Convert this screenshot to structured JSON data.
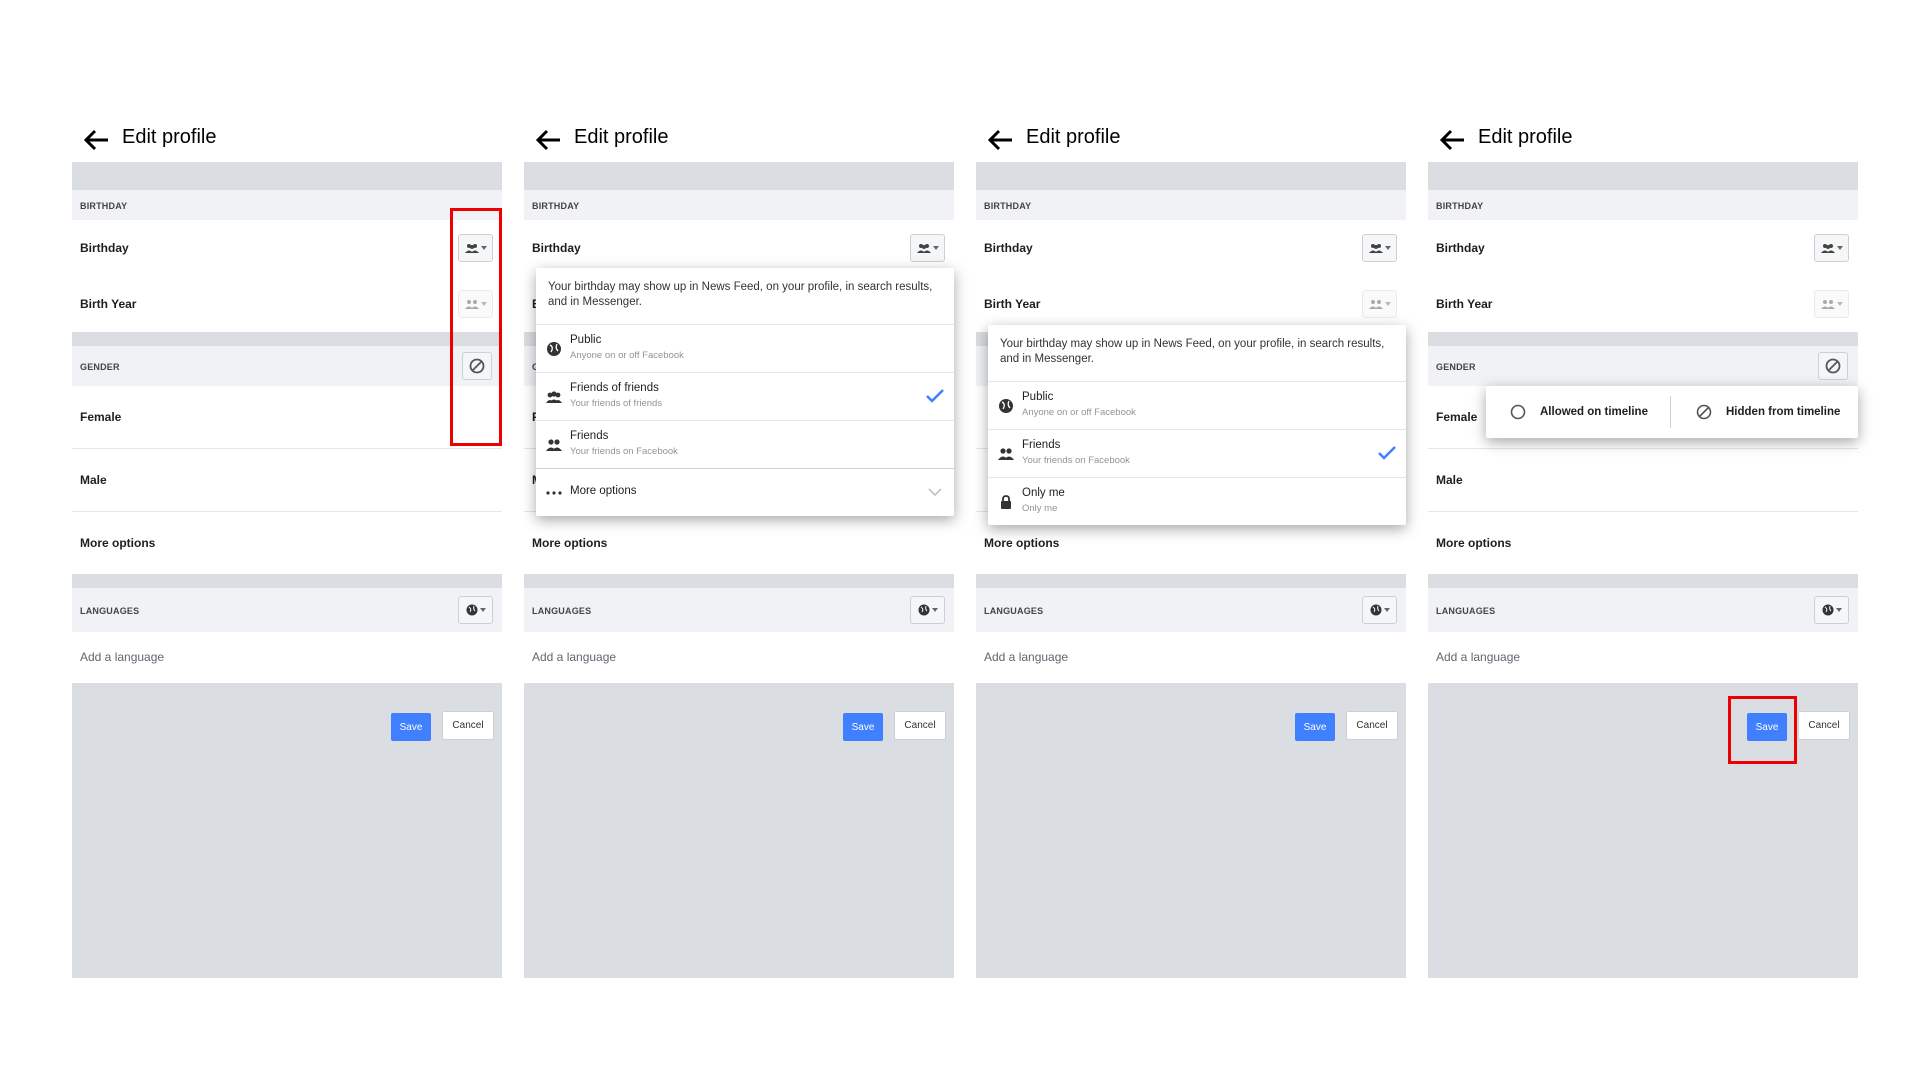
{
  "panels": [
    {
      "title": "Edit profile"
    },
    {
      "title": "Edit profile"
    },
    {
      "title": "Edit profile"
    },
    {
      "title": "Edit profile"
    }
  ],
  "sections": {
    "birthday": "BIRTHDAY",
    "gender": "GENDER",
    "languages": "LANGUAGES"
  },
  "rows": {
    "birthday": "Birthday",
    "birth_year": "Birth Year",
    "female": "Female",
    "male": "Male",
    "more_options": "More options"
  },
  "add_language": "Add a language",
  "buttons": {
    "save": "Save",
    "cancel": "Cancel"
  },
  "dropdown1": {
    "note": "Your birthday may show up in News Feed, on your profile, in search results, and in Messenger.",
    "items": [
      {
        "title": "Public",
        "subtitle": "Anyone on or off Facebook",
        "icon": "globe-icon"
      },
      {
        "title": "Friends of friends",
        "subtitle": "Your friends of friends",
        "icon": "friends-of-friends-icon",
        "selected": true
      },
      {
        "title": "Friends",
        "subtitle": "Your friends on Facebook",
        "icon": "friends-icon"
      },
      {
        "title": "More options",
        "icon": "more-dots-icon"
      }
    ]
  },
  "dropdown2": {
    "note": "Your birthday may show up in News Feed, on your profile, in search results, and in Messenger.",
    "items": [
      {
        "title": "Public",
        "subtitle": "Anyone on or off Facebook",
        "icon": "globe-icon"
      },
      {
        "title": "Friends",
        "subtitle": "Your friends on Facebook",
        "icon": "friends-icon",
        "selected": true
      },
      {
        "title": "Only me",
        "subtitle": "Only me",
        "icon": "lock-icon"
      }
    ]
  },
  "timeline": {
    "allowed": "Allowed on timeline",
    "hidden": "Hidden from timeline"
  },
  "colors": {
    "accent": "#4080ff",
    "highlight": "#e00000",
    "band": "#dadde1",
    "section": "#f0f2f5"
  }
}
